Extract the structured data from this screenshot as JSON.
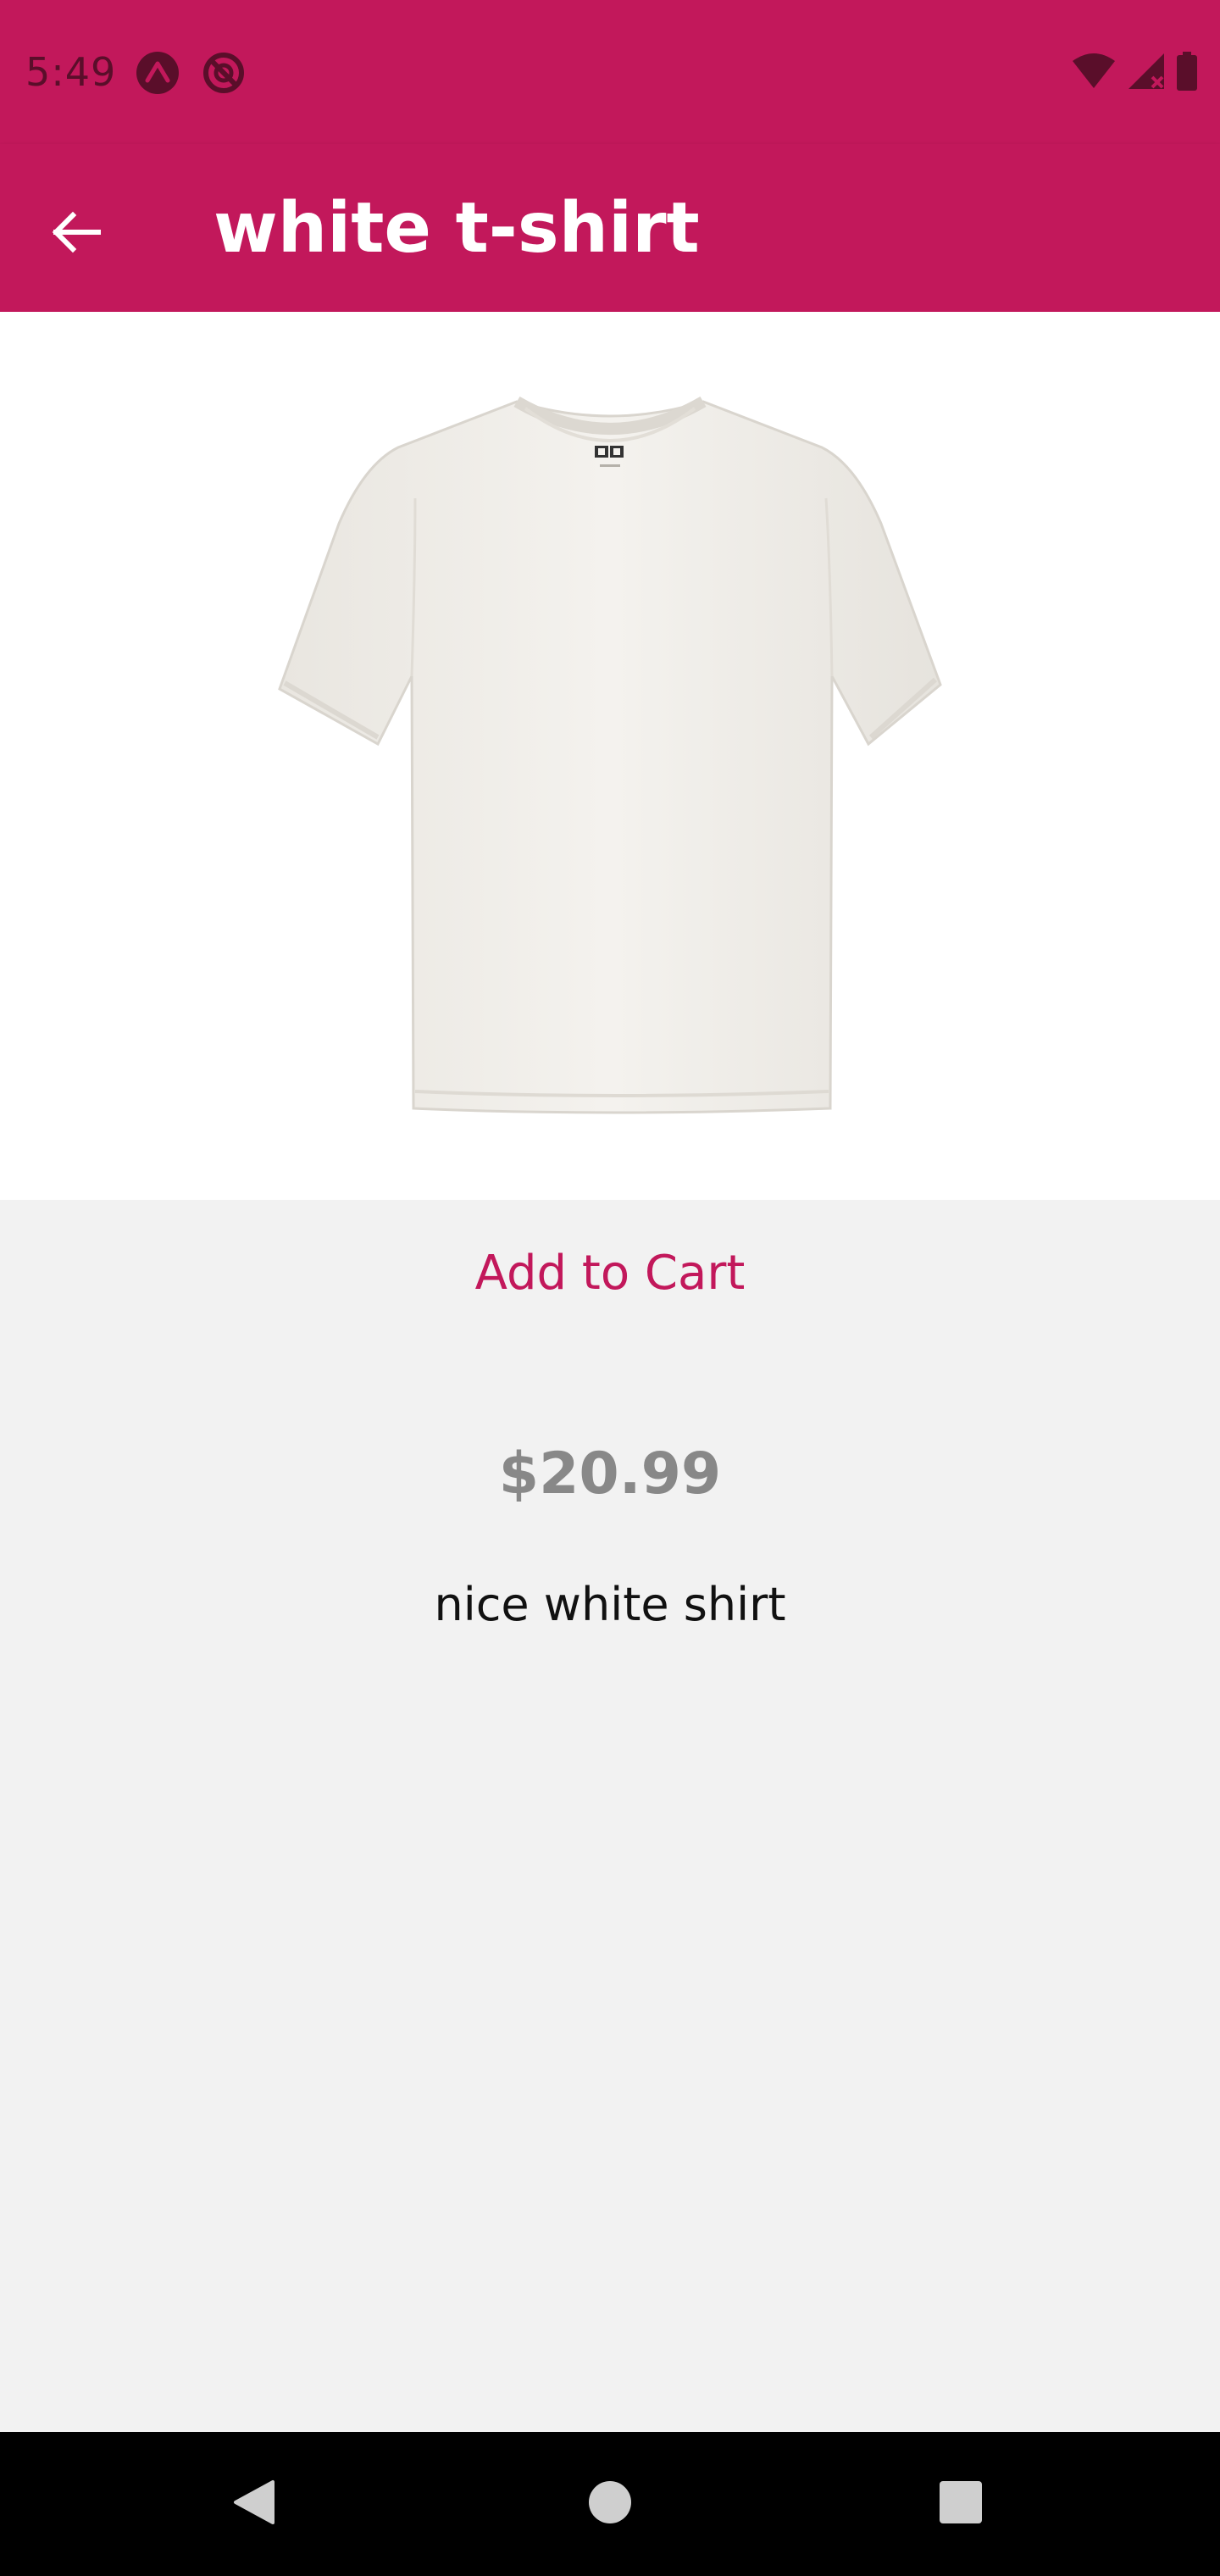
{
  "status_bar": {
    "time": "5:49",
    "icons_left": [
      "expo-icon",
      "sync-disabled-icon"
    ],
    "icons_right": [
      "wifi-icon",
      "cell-signal-icon",
      "battery-icon"
    ]
  },
  "header": {
    "title": "white t-shirt",
    "back_icon": "arrow-left-icon"
  },
  "product": {
    "image_icon": "white-tshirt-image",
    "add_to_cart_label": "Add to Cart",
    "price": "$20.99",
    "description": "nice white shirt"
  },
  "nav_bar": {
    "icons": [
      "back-triangle-icon",
      "home-circle-icon",
      "recents-square-icon"
    ]
  },
  "colors": {
    "primary": "#c2185b",
    "background": "#f2f2f2",
    "price": "#888888"
  }
}
